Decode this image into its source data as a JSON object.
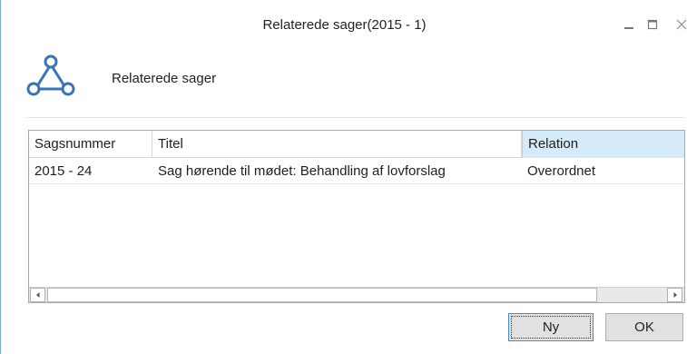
{
  "window": {
    "title": "Relaterede sager(2015 - 1)",
    "controls": {
      "minimize": "minimize-icon",
      "maximize": "maximize-icon",
      "close": "close-icon"
    }
  },
  "header": {
    "icon": "relation-graph-icon",
    "label": "Relaterede sager",
    "accent_color": "#3b73b9"
  },
  "grid": {
    "columns": [
      "Sagsnummer",
      "Titel",
      "Relation"
    ],
    "sorted_column_highlight": "#d6ebfa",
    "rows": [
      {
        "sagsnummer": "2015 - 24",
        "titel": "Sag hørende til mødet: Behandling af lovforslag",
        "relation": "Overordnet"
      }
    ]
  },
  "buttons": {
    "new": "Ny",
    "ok": "OK"
  }
}
